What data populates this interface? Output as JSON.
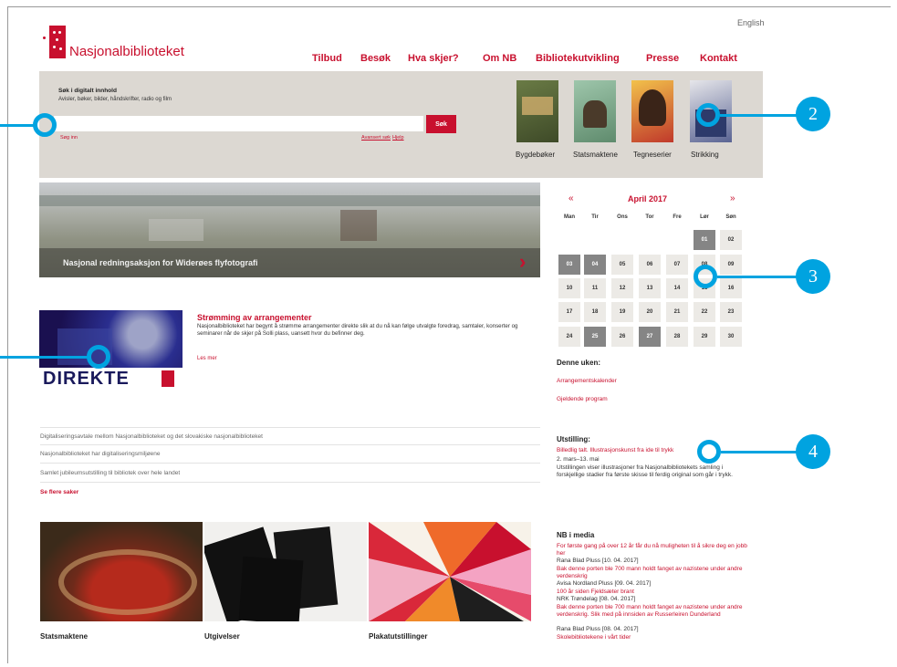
{
  "header": {
    "language_link": "English",
    "logo_text": "Nasjonalbiblioteket",
    "nav": [
      "Tilbud",
      "Besøk",
      "Hva skjer?",
      "Om NB",
      "Bibliotekutvikling",
      "Presse",
      "Kontakt"
    ]
  },
  "search": {
    "title": "Søk i digitalt innhold",
    "subtitle": "Avisler, bøker, bilder, håndskrifter, radio og film",
    "input_value": "",
    "button_label": "Søk",
    "link_left": "Søg inn",
    "link_advanced": "Avansert søk",
    "link_help": "Hjelp"
  },
  "books": [
    {
      "label": "Bygdebøker",
      "color": "#5a6b3a"
    },
    {
      "label": "Statsmaktene",
      "color": "#7aa58a"
    },
    {
      "label": "Tegneserier",
      "color": "#d9a13b"
    },
    {
      "label": "Strikking",
      "color": "#3d4a78"
    }
  ],
  "hero": {
    "caption": "Nasjonal redningsaksjon for Widerøes flyfotografi"
  },
  "calendar": {
    "month": "April 2017",
    "prev": "«",
    "next": "»",
    "weekdays": [
      "Man",
      "Tir",
      "Ons",
      "Tor",
      "Fre",
      "Lør",
      "Søn"
    ],
    "weeks": [
      [
        "",
        "",
        "",
        "",
        "",
        "01",
        "02"
      ],
      [
        "03",
        "04",
        "05",
        "06",
        "07",
        "08",
        "09"
      ],
      [
        "10",
        "11",
        "12",
        "13",
        "14",
        "15",
        "16"
      ],
      [
        "17",
        "18",
        "19",
        "20",
        "21",
        "22",
        "23"
      ],
      [
        "24",
        "25",
        "26",
        "27",
        "28",
        "29",
        "30"
      ]
    ],
    "highlighted": [
      "01",
      "03",
      "04",
      "25",
      "27"
    ]
  },
  "week": {
    "heading": "Denne uken:",
    "link1": "Arrangementskalender",
    "link2": "Gjeldende program"
  },
  "exhibition": {
    "heading": "Utstilling:",
    "link": "Billedlig talt. Illustrasjonskunst fra ide til trykk",
    "dates": "2. mars–13. mai",
    "body": "Utstillingen viser illustrasjoner fra Nasjonalbibliotekets samling i forskjellige stadier fra første skisse til ferdig original som går i trykk."
  },
  "news": {
    "image_text": "DIREKTE",
    "title": "Strømming av arrangementer",
    "body": "Nasjonalbiblioteket har begynt å strømme arrangementer direkte slik at du nå kan følge utvalgte foredrag, samtaler, konserter og seminarer når de skjer på Solli plass, uansett hvor du befinner deg.",
    "more": "Les mer"
  },
  "list": {
    "items": [
      "Digitaliseringsavtale mellom Nasjonalbiblioteket og det slovakiske nasjonalbiblioteket",
      "Nasjonalbiblioteket har digitaliseringsmiljøene",
      "Samlet jubileumsutstilling til bibliotek over hele landet"
    ],
    "see_more": "Se flere saker"
  },
  "tiles": [
    {
      "label": "Statsmaktene"
    },
    {
      "label": "Utgivelser"
    },
    {
      "label": "Plakatutstillinger"
    }
  ],
  "media": {
    "heading": "NB i media",
    "entries": [
      {
        "title": "For første gang på over 12 år får du nå muligheten til å sikre deg en jobb her",
        "source": "Rana Blad Pluss [10. 04. 2017]"
      },
      {
        "title": "Bak denne porten ble 700 mann holdt fanget av nazistene under andre verdenskrig",
        "source": "Avisa Nordland Pluss [09. 04. 2017]"
      },
      {
        "title": "100 år siden Fjeldsæter brant",
        "source": "NRK Trøndelag [08. 04. 2017]"
      },
      {
        "title": "Bak denne porten ble 700 mann holdt fanget av nazistene under andre verdenskrig. Slik med på innsiden av Russerleiren Dunderland",
        "source": "Rana Blad Pluss [08. 04. 2017]"
      },
      {
        "title": "Skolebibliotekene i vårt tider",
        "source": ""
      }
    ]
  },
  "callouts": [
    "2",
    "3",
    "4"
  ]
}
